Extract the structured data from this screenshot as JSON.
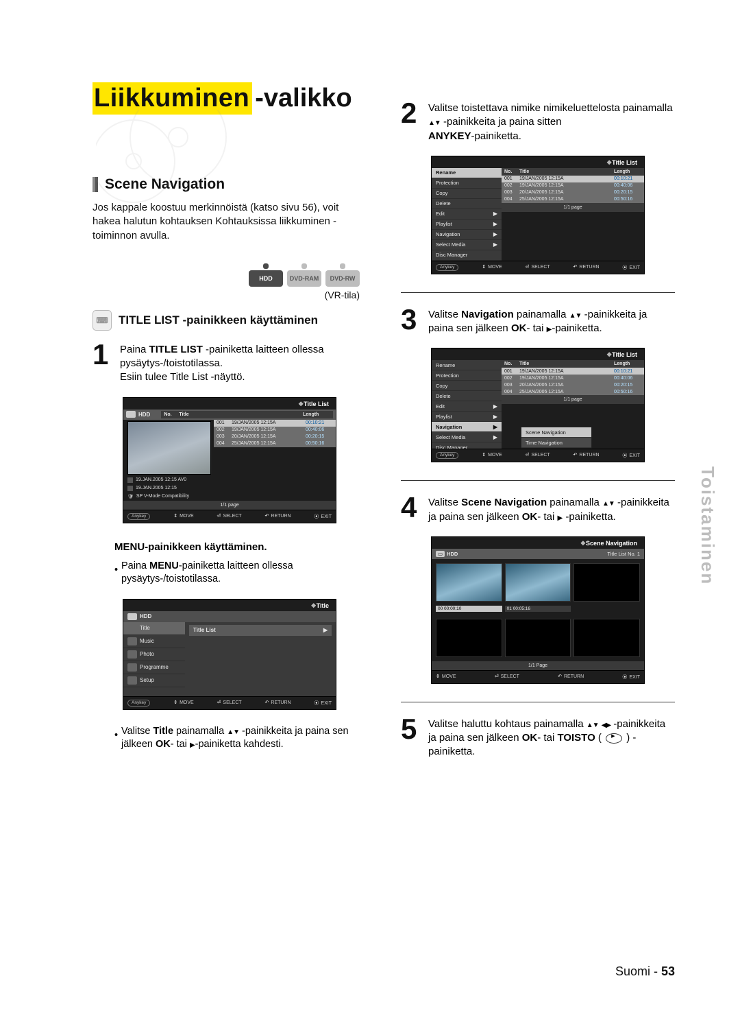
{
  "page": {
    "title_highlight": "Liikkuminen",
    "title_rest": "-valikko",
    "side_label": "Toistaminen",
    "footer_lang": "Suomi",
    "footer_sep": " - ",
    "footer_page": "53"
  },
  "left": {
    "section_title": "Scene Navigation",
    "intro": "Jos kappale koostuu merkinnöistä (katso sivu 56), voit hakea halutun kohtauksen Kohtauksissa liikkuminen -toiminnon avulla.",
    "badges": {
      "hdd": "HDD",
      "ram": "DVD-RAM",
      "rw": "DVD-RW"
    },
    "vr": "(VR-tila)",
    "subhead": "TITLE LIST -painikkeen käyttäminen",
    "step1_a": "Paina ",
    "step1_b": "TITLE LIST",
    "step1_c": " -painiketta laitteen ollessa pysäytys-/toistotilassa.",
    "step1_d": "Esiin tulee Title List -näyttö.",
    "subhead2": "MENU-painikkeen käyttäminen.",
    "bullet1_a": "Paina ",
    "bullet1_b": "MENU",
    "bullet1_c": "-painiketta laitteen ollessa pysäytys-/toistotilassa.",
    "bullet2_a": "Valitse ",
    "bullet2_b": "Title",
    "bullet2_c": " painamalla ",
    "bullet2_d": " -painikkeita ja paina sen jälkeen ",
    "bullet2_e": "OK",
    "bullet2_f": "- tai ",
    "bullet2_g": "-painiketta kahdesti."
  },
  "right": {
    "step2_a": "Valitse toistettava nimike nimikeluettelosta painamalla ",
    "step2_b": " -painikkeita ja paina sitten ",
    "step2_c": "ANYKEY",
    "step2_d": "-painiketta.",
    "step3_a": "Valitse ",
    "step3_b": "Navigation",
    "step3_c": " painamalla ",
    "step3_d": " -painikkeita ja paina sen jälkeen ",
    "step3_e": "OK",
    "step3_f": "- tai ",
    "step3_g": "-painiketta.",
    "step4_a": "Valitse ",
    "step4_b": "Scene Navigation",
    "step4_c": " painamalla ",
    "step4_d": " -painikkeita ja paina sen jälkeen ",
    "step4_e": "OK",
    "step4_f": "- tai ",
    "step4_g": " -painiketta.",
    "step5_a": "Valitse haluttu kohtaus painamalla ",
    "step5_b": " -painikkeita ja paina sen jälkeen ",
    "step5_c": "OK",
    "step5_d": "- tai ",
    "step5_e": "TOISTO",
    "step5_f": " ( ",
    "step5_g": " ) -painiketta."
  },
  "osd": {
    "titlelist": "Title List",
    "title_menu": "Title",
    "scene_nav": "Scene Navigation",
    "hdd": "HDD",
    "cols": {
      "no": "No.",
      "title": "Title",
      "length": "Length"
    },
    "rows": [
      {
        "no": "001",
        "title": "19/JAN/2005 12:15A",
        "len": "00:10:21"
      },
      {
        "no": "002",
        "title": "19/JAN/2005 12:15A",
        "len": "00:40:06"
      },
      {
        "no": "003",
        "title": "20/JAN/2005 12:15A",
        "len": "00:20:15"
      },
      {
        "no": "004",
        "title": "25/JAN/2005 12:15A",
        "len": "00:50:16"
      }
    ],
    "info1": "19.JAN.2005 12:15 AV0",
    "info2": "19.JAN.2005 12:15",
    "info3": "SP  V-Mode Compatibility",
    "page": "1/1 page",
    "page2": "1/1 Page",
    "hints": {
      "anykey": "Anykey",
      "move": "MOVE",
      "select": "SELECT",
      "ret": "RETURN",
      "exit": "EXIT"
    },
    "menu_items": [
      "Rename",
      "Protection",
      "Copy",
      "Delete",
      "Edit",
      "Playlist",
      "Navigation",
      "Select Media",
      "Disc Manager"
    ],
    "nav_popup": [
      "Scene Navigation",
      "Time Navigation"
    ],
    "left_menu": {
      "title": "Title",
      "titlelist": "Title List",
      "music": "Music",
      "photo": "Photo",
      "programme": "Programme",
      "setup": "Setup"
    },
    "scene_header": "Title List No. 1",
    "scene_caps": [
      "00  00:00:10",
      "01  00:05:16"
    ]
  }
}
